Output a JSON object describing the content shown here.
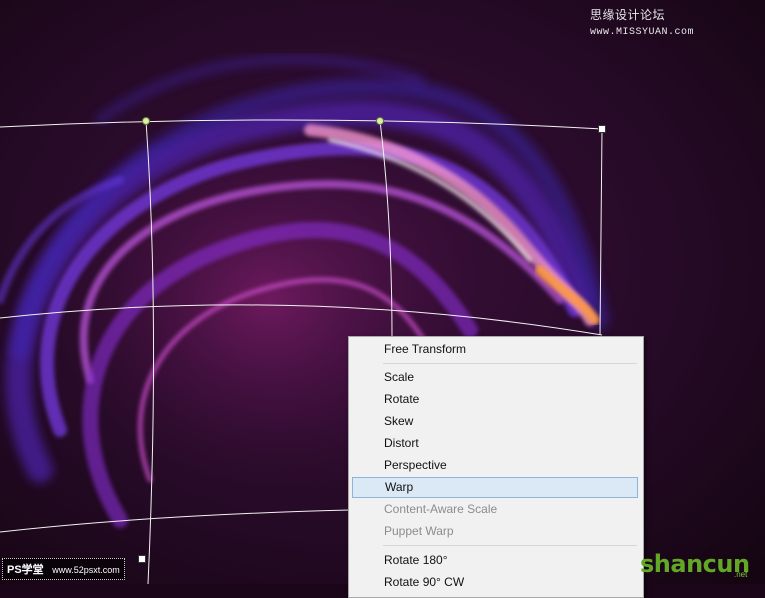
{
  "context_menu": {
    "items": [
      {
        "label": "Free Transform",
        "enabled": true
      },
      {
        "label": "Scale",
        "enabled": true
      },
      {
        "label": "Rotate",
        "enabled": true
      },
      {
        "label": "Skew",
        "enabled": true
      },
      {
        "label": "Distort",
        "enabled": true
      },
      {
        "label": "Perspective",
        "enabled": true
      },
      {
        "label": "Warp",
        "enabled": true,
        "highlighted": true
      },
      {
        "label": "Content-Aware Scale",
        "enabled": false
      },
      {
        "label": "Puppet Warp",
        "enabled": false
      },
      {
        "label": "Rotate 180°",
        "enabled": true
      },
      {
        "label": "Rotate 90° CW",
        "enabled": true
      }
    ]
  },
  "watermarks": {
    "top_right": "思缘设计论坛",
    "top_right_domain": "www.MISSYUAN.com",
    "bottom_left_brand": "PS学堂",
    "bottom_left_url": "www.52psxt.com",
    "bottom_right_logo": "shancun",
    "bottom_right_sub": ".net"
  },
  "colors": {
    "background": "#1a0618",
    "highlight_bg": "#dbe9f7",
    "highlight_border": "#8fb4d9",
    "disabled_text": "#8c8c8c",
    "logo_green": "#62a825"
  }
}
